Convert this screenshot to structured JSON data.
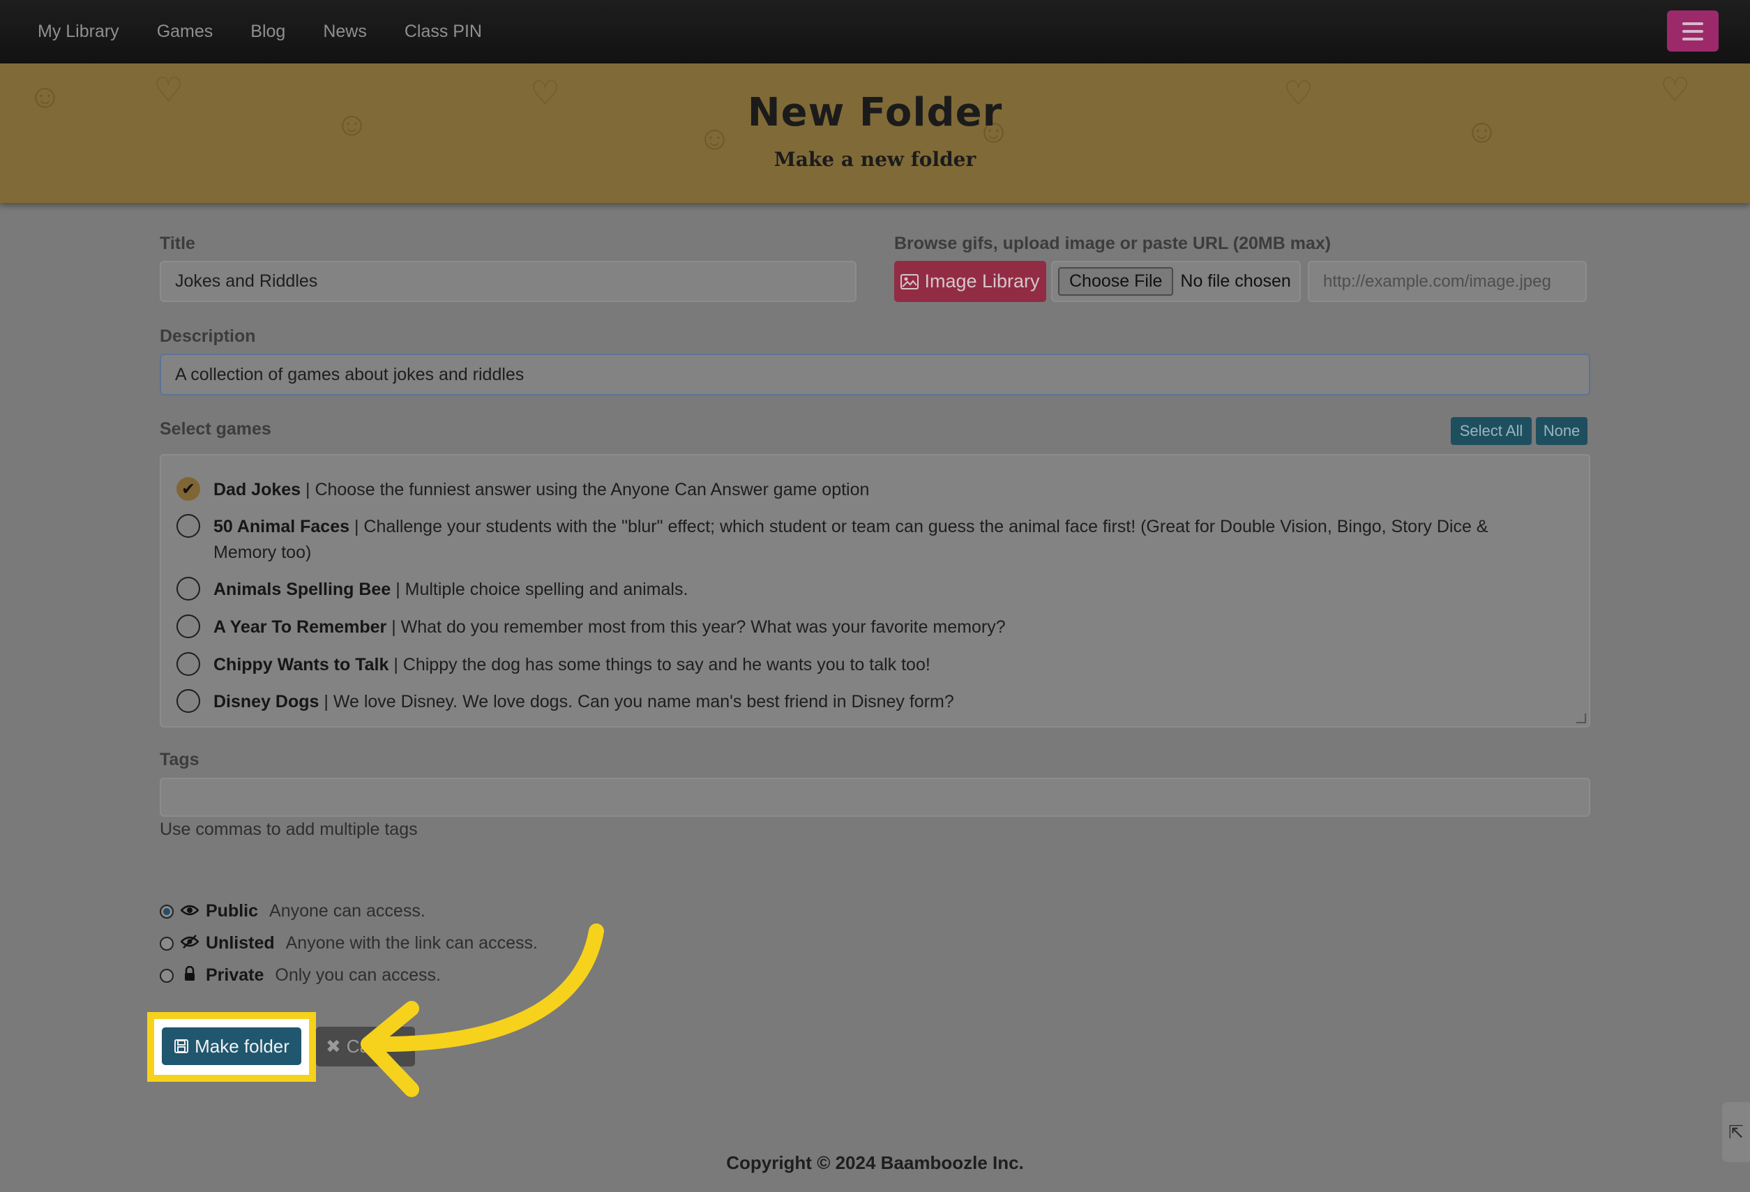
{
  "nav": {
    "items": [
      {
        "label": "My Library"
      },
      {
        "label": "Games"
      },
      {
        "label": "Blog"
      },
      {
        "label": "News"
      },
      {
        "label": "Class PIN"
      }
    ],
    "menu_icon": "hamburger-icon"
  },
  "header": {
    "title": "New Folder",
    "subtitle": "Make a new folder"
  },
  "form": {
    "title_label": "Title",
    "title_value": "Jokes and Riddles",
    "image_label": "Browse gifs, upload image or paste URL (20MB max)",
    "image_library_label": "Image Library",
    "choose_file_label": "Choose File",
    "no_file_label": "No file chosen",
    "url_placeholder": "http://example.com/image.jpeg",
    "description_label": "Description",
    "description_value": "A collection of games about jokes and riddles",
    "select_games_label": "Select games",
    "select_all_label": "Select All",
    "none_label": "None",
    "games": [
      {
        "name": "Dad Jokes",
        "desc": " | Choose the funniest answer using the Anyone Can Answer game option",
        "checked": true
      },
      {
        "name": "50 Animal Faces",
        "desc": " | Challenge your students with the \"blur\" effect; which student or team can guess the animal face first! (Great for Double Vision, Bingo, Story Dice & Memory too)",
        "checked": false
      },
      {
        "name": "Animals Spelling Bee",
        "desc": " | Multiple choice spelling and animals.",
        "checked": false
      },
      {
        "name": "A Year To Remember",
        "desc": " | What do you remember most from this year? What was your favorite memory?",
        "checked": false
      },
      {
        "name": "Chippy Wants to Talk",
        "desc": " | Chippy the dog has some things to say and he wants you to talk too!",
        "checked": false
      },
      {
        "name": "Disney Dogs",
        "desc": " | We love Disney. We love dogs. Can you name man's best friend in Disney form?",
        "checked": false
      }
    ],
    "tags_label": "Tags",
    "tags_value": "",
    "tags_help": "Use commas to add multiple tags",
    "visibility": [
      {
        "label": "Public",
        "desc": "Anyone can access.",
        "icon": "eye-icon",
        "selected": true
      },
      {
        "label": "Unlisted",
        "desc": "Anyone with the link can access.",
        "icon": "eye-slash-icon",
        "selected": false
      },
      {
        "label": "Private",
        "desc": "Only you can access.",
        "icon": "lock-icon",
        "selected": false
      }
    ],
    "make_folder_label": "Make folder",
    "cancel_label": "Ca"
  },
  "footer": {
    "copyright": "Copyright © 2024 Baamboozle Inc."
  },
  "colors": {
    "highlight": "#f6d21c",
    "primary_button": "#20566e",
    "image_library_button": "#922c44",
    "header_bg": "#806a37"
  }
}
